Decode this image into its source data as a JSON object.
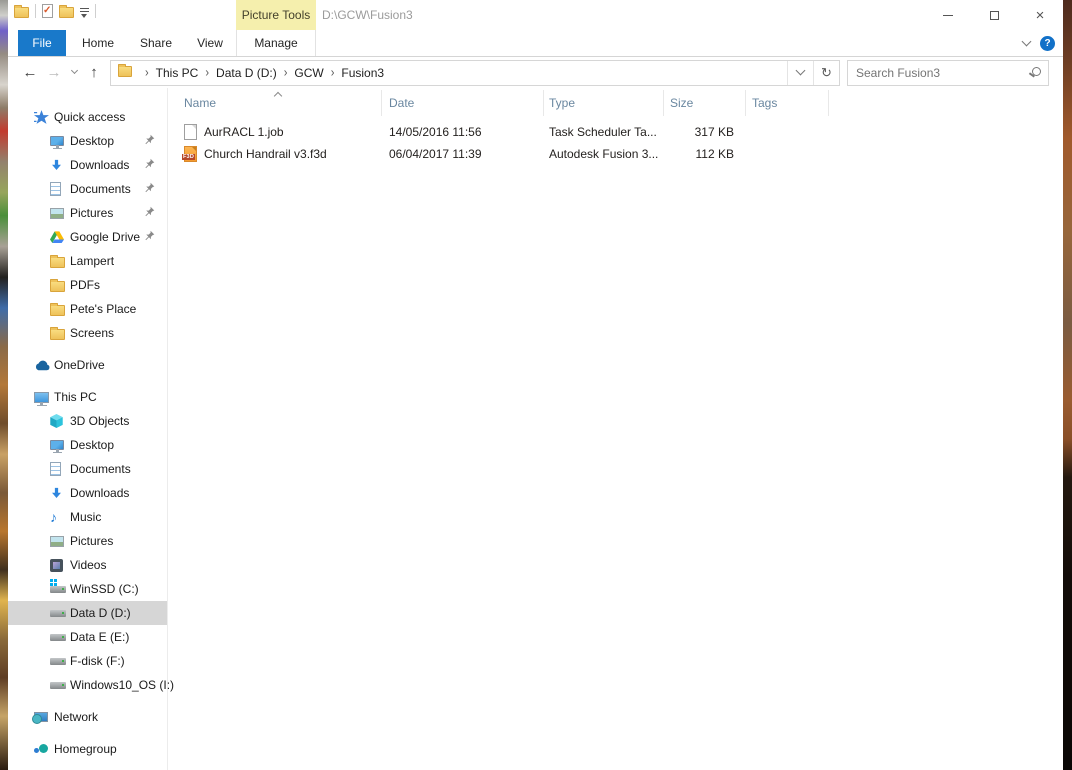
{
  "window": {
    "title": "D:\\GCW\\Fusion3",
    "contextual_group": "Picture Tools"
  },
  "ribbon": {
    "tabs": {
      "file": "File",
      "home": "Home",
      "share": "Share",
      "view": "View",
      "manage": "Manage"
    },
    "help": "?"
  },
  "navigation": {
    "breadcrumb": [
      "This PC",
      "Data D (D:)",
      "GCW",
      "Fusion3"
    ],
    "separator": "›",
    "refresh_glyph": "↻",
    "back_glyph": "←",
    "forward_glyph": "→",
    "up_glyph": "↑",
    "search": {
      "placeholder": "Search Fusion3"
    }
  },
  "sidebar": {
    "sections": [
      {
        "label": "Quick access",
        "icon": "quick-access-star-icon",
        "items": [
          {
            "label": "Desktop",
            "icon": "desktop-icon",
            "pinned": true
          },
          {
            "label": "Downloads",
            "icon": "downloads-arrow-icon",
            "pinned": true
          },
          {
            "label": "Documents",
            "icon": "documents-icon",
            "pinned": true
          },
          {
            "label": "Pictures",
            "icon": "pictures-icon",
            "pinned": true
          },
          {
            "label": "Google Drive",
            "icon": "google-drive-icon",
            "pinned": true
          },
          {
            "label": "Lampert",
            "icon": "folder-icon",
            "pinned": false
          },
          {
            "label": "PDFs",
            "icon": "folder-icon",
            "pinned": false
          },
          {
            "label": "Pete's Place",
            "icon": "folder-icon",
            "pinned": false
          },
          {
            "label": "Screens",
            "icon": "folder-icon",
            "pinned": false
          }
        ]
      },
      {
        "label": "OneDrive",
        "icon": "onedrive-cloud-icon",
        "items": []
      },
      {
        "label": "This PC",
        "icon": "this-pc-icon",
        "items": [
          {
            "label": "3D Objects",
            "icon": "3d-cube-icon"
          },
          {
            "label": "Desktop",
            "icon": "desktop-icon"
          },
          {
            "label": "Documents",
            "icon": "documents-icon"
          },
          {
            "label": "Downloads",
            "icon": "downloads-arrow-icon"
          },
          {
            "label": "Music",
            "icon": "music-note-icon"
          },
          {
            "label": "Pictures",
            "icon": "pictures-icon"
          },
          {
            "label": "Videos",
            "icon": "videos-film-icon"
          },
          {
            "label": "WinSSD (C:)",
            "icon": "system-drive-icon"
          },
          {
            "label": "Data D (D:)",
            "icon": "drive-icon",
            "selected": true
          },
          {
            "label": "Data E (E:)",
            "icon": "drive-icon"
          },
          {
            "label": "F-disk (F:)",
            "icon": "drive-icon"
          },
          {
            "label": "Windows10_OS (I:)",
            "icon": "drive-icon"
          }
        ]
      },
      {
        "label": "Network",
        "icon": "network-icon",
        "items": []
      },
      {
        "label": "Homegroup",
        "icon": "homegroup-icon",
        "items": []
      }
    ]
  },
  "file_list": {
    "columns": [
      "Name",
      "Date",
      "Type",
      "Size",
      "Tags"
    ],
    "sort": {
      "column": "Name",
      "direction": "ascending"
    },
    "rows": [
      {
        "name": "AurRACL 1.job",
        "date": "14/05/2016 11:56",
        "type": "Task Scheduler Ta...",
        "size": "317 KB",
        "tags": "",
        "icon": "job-file-icon",
        "badge": ""
      },
      {
        "name": "Church Handrail v3.f3d",
        "date": "06/04/2017 11:39",
        "type": "Autodesk Fusion 3...",
        "size": "112 KB",
        "tags": "",
        "icon": "f3d-file-icon",
        "badge": "F3D"
      }
    ]
  },
  "colors": {
    "file_tab_blue": "#1979ca",
    "contextual_tab_yellow": "#f5efad",
    "selected_item_gray": "#d6d6d6",
    "header_text_blue_gray": "#6a87a0",
    "f3d_orange": "#f59a2e",
    "f3d_badge_red": "#b5472a",
    "title_text_gray": "#9b9b9b"
  },
  "icons": [
    "folder-icon",
    "properties-check-icon",
    "qat-dropdown-icon",
    "minimize-icon",
    "maximize-icon",
    "close-icon",
    "ribbon-collapse-chevron-icon",
    "help-icon",
    "back-icon",
    "forward-icon",
    "history-chevron-icon",
    "up-icon",
    "breadcrumb-folder-icon",
    "address-dropdown-chevron-icon",
    "refresh-icon",
    "search-icon",
    "pin-icon",
    "sort-ascending-caret-icon"
  ]
}
